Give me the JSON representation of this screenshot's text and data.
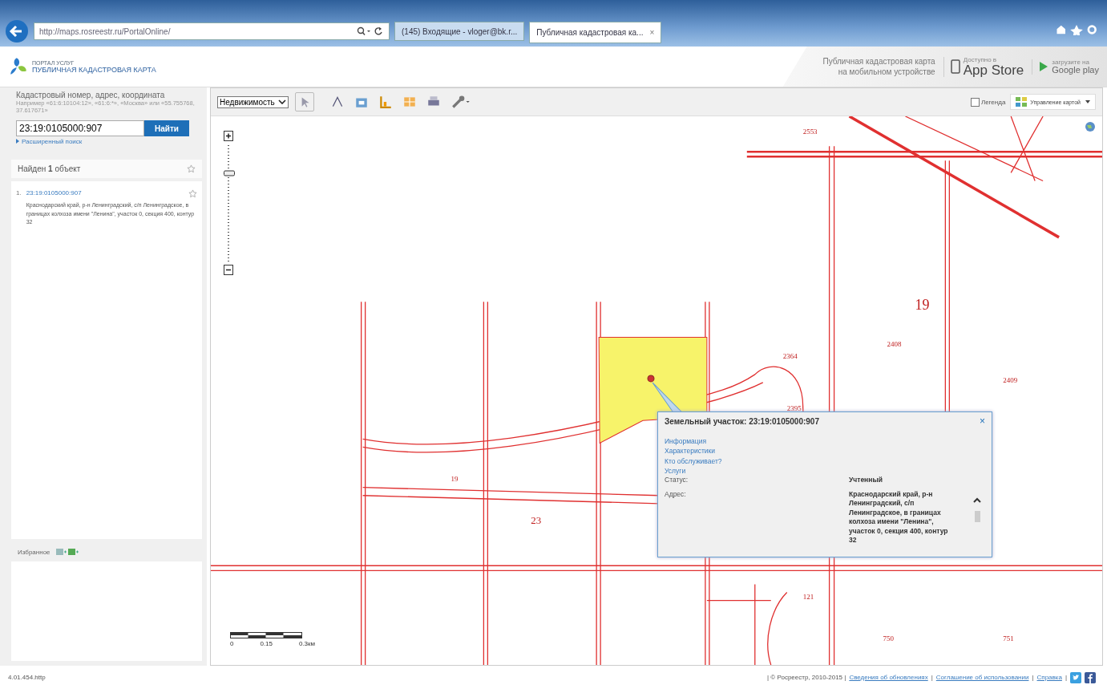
{
  "browser": {
    "address": "http://maps.rosreestr.ru/PortalOnline/",
    "tabs": [
      {
        "label": "(145) Входящие - vloger@bk.r...",
        "selected": false
      },
      {
        "label": "Публичная кадастровая ка...",
        "selected": true,
        "close": "×"
      }
    ]
  },
  "header": {
    "logo_top": "ПОРТАЛ УСЛУГ",
    "logo_title": "ПУБЛИЧНАЯ КАДАСТРОВАЯ КАРТА",
    "promo": "Публичная кадастровая карта на мобильном устройстве",
    "app_store": {
      "small": "Доступно в",
      "big": "App Store"
    },
    "google_play": {
      "small": "загрузите на",
      "big": "Google play"
    }
  },
  "search": {
    "label": "Кадастровый номер, адрес, координата",
    "hint": "Например «61:6:10104:12», «61:6:*», «Москва» или «55.755768, 37.617671»",
    "value": "23:19:0105000:907",
    "button": "Найти",
    "advanced_link": "Расширенный поиск"
  },
  "results": {
    "title": "Найден **1** объект",
    "items": [
      {
        "index": "1.",
        "number": "23:19:0105000:907",
        "address": "Краснодарский край, р-н Ленинградский, с/п Ленинградское, в границах колхоза имени \"Ленина\", участок 0, секция 400, контур 32"
      }
    ]
  },
  "favorites": {
    "title": "Избранное"
  },
  "toolbar": {
    "layer_select": "Недвижимость",
    "legend": {
      "label": "Легенда",
      "checked": false
    },
    "map_control": "Управление картой"
  },
  "zoom": {
    "level": 0.75
  },
  "map": {
    "labels": [
      {
        "text": "2553"
      },
      {
        "text": "19"
      },
      {
        "text": "2364"
      },
      {
        "text": "2408"
      },
      {
        "text": "2409"
      },
      {
        "text": "2395"
      },
      {
        "text": "19"
      },
      {
        "text": "23"
      },
      {
        "text": "121"
      },
      {
        "text": "750"
      },
      {
        "text": "751"
      }
    ],
    "scale": [
      "0",
      "0.15",
      "0.3км"
    ]
  },
  "popup": {
    "title": "Земельный участок: 23:19:0105000:907",
    "close": "×",
    "links": [
      "Информация",
      "Характеристики",
      "Кто обслуживает?",
      "Услуги"
    ],
    "rows": [
      {
        "label": "Статус:",
        "value": "Учтенный"
      },
      {
        "label": "Адрес:",
        "value": "Краснодарский край, р-н Ленинградский, с/п Ленинградское, в границах колхоза имени \"Ленина\", участок 0, секция 400, контур 32"
      }
    ]
  },
  "footer": {
    "version": "4.01.454.http",
    "copyright": "| © Росреестр, 2010-2015 |",
    "links": [
      "Сведения об обновлениях",
      "Соглашение об использовании",
      "Справка"
    ],
    "separator": "|"
  }
}
